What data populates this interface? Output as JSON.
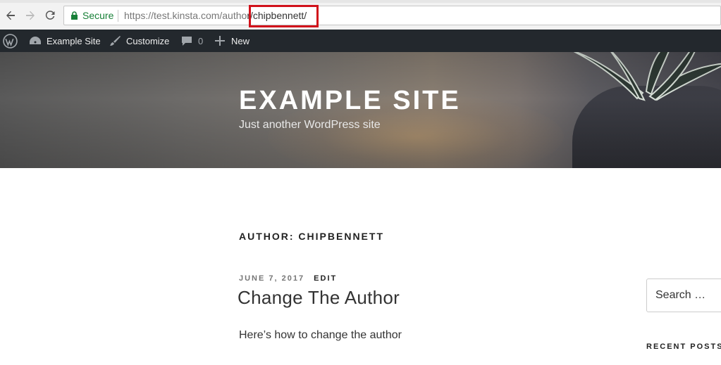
{
  "browser": {
    "secure_label": "Secure",
    "url_base": "https://test.kinsta.com/autho",
    "url_highlight": "r/chipbennett/"
  },
  "adminbar": {
    "site_name": "Example Site",
    "customize": "Customize",
    "comments_count": "0",
    "new_label": "New"
  },
  "header": {
    "site_title": "EXAMPLE SITE",
    "tagline": "Just another WordPress site"
  },
  "content": {
    "page_title": "AUTHOR: CHIPBENNETT",
    "post_date": "JUNE 7, 2017",
    "edit_label": "EDIT",
    "post_title": "Change The Author",
    "post_excerpt": "Here’s how to change the author"
  },
  "sidebar": {
    "search_placeholder": "Search …",
    "recent_posts_heading": "RECENT POSTS"
  }
}
